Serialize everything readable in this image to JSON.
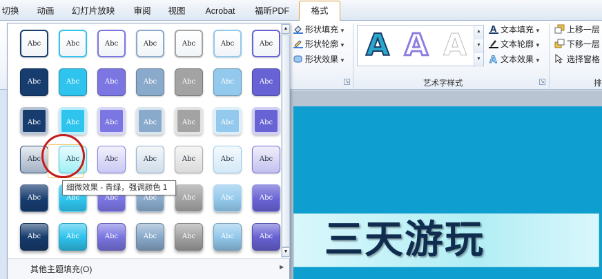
{
  "tabs": [
    {
      "label": "切换",
      "active": false
    },
    {
      "label": "动画",
      "active": false
    },
    {
      "label": "幻灯片放映",
      "active": false
    },
    {
      "label": "审阅",
      "active": false
    },
    {
      "label": "视图",
      "active": false
    },
    {
      "label": "Acrobat",
      "active": false
    },
    {
      "label": "福昕PDF",
      "active": false
    },
    {
      "label": "格式",
      "active": true
    }
  ],
  "ribbon": {
    "shape_fill": "形状填充",
    "shape_outline": "形状轮廓",
    "shape_effects": "形状效果",
    "wordart_glyph": "A",
    "wordart_group_label": "艺术字样式",
    "text_fill": "文本填充",
    "text_outline": "文本轮廓",
    "text_effects": "文本效果",
    "bring_forward": "上移一层",
    "send_backward": "下移一层",
    "selection_pane": "选择窗格",
    "arrange_group_label": "排"
  },
  "gallery": {
    "swatch_label": "Abc",
    "columns": 7,
    "rows": [
      {
        "style": "outline",
        "colors": [
          "#173c6e",
          "#2fc4ee",
          "#7b76e2",
          "#8aaacb",
          "#a3a3a3",
          "#93c9ec",
          "#6863d4"
        ]
      },
      {
        "style": "solid",
        "colors": [
          "#173c6e",
          "#2fc4ee",
          "#7b76e2",
          "#8aaacb",
          "#a3a3a3",
          "#93c9ec",
          "#6863d4"
        ]
      },
      {
        "style": "soft",
        "colors": [
          "#173c6e",
          "#2fc4ee",
          "#7b76e2",
          "#8aaacb",
          "#a3a3a3",
          "#93c9ec",
          "#6863d4"
        ]
      },
      {
        "style": "subtle",
        "colors": [
          "#173c6e",
          "#2fc4ee",
          "#7b76e2",
          "#8aaacb",
          "#a3a3a3",
          "#93c9ec",
          "#6863d4"
        ]
      },
      {
        "style": "moderate",
        "colors": [
          "#173c6e",
          "#2fc4ee",
          "#7b76e2",
          "#8aaacb",
          "#a3a3a3",
          "#93c9ec",
          "#6863d4"
        ]
      },
      {
        "style": "intense",
        "colors": [
          "#173c6e",
          "#2fc4ee",
          "#7b76e2",
          "#8aaacb",
          "#a3a3a3",
          "#93c9ec",
          "#6863d4"
        ]
      }
    ],
    "hovered": {
      "row": 3,
      "col": 1
    },
    "more_fills": "其他主题填充(O)",
    "scroll_up": "▲",
    "scroll_down": "▼"
  },
  "tooltip": "细微效果 - 青绿，强调颜色 1",
  "slide": {
    "title": "三天游玩"
  },
  "colors": {
    "accent": "#2fc4ee",
    "highlight_circle": "#c31c1c",
    "slide_background": "#0f9ed0",
    "title_text": "#102c4e"
  }
}
